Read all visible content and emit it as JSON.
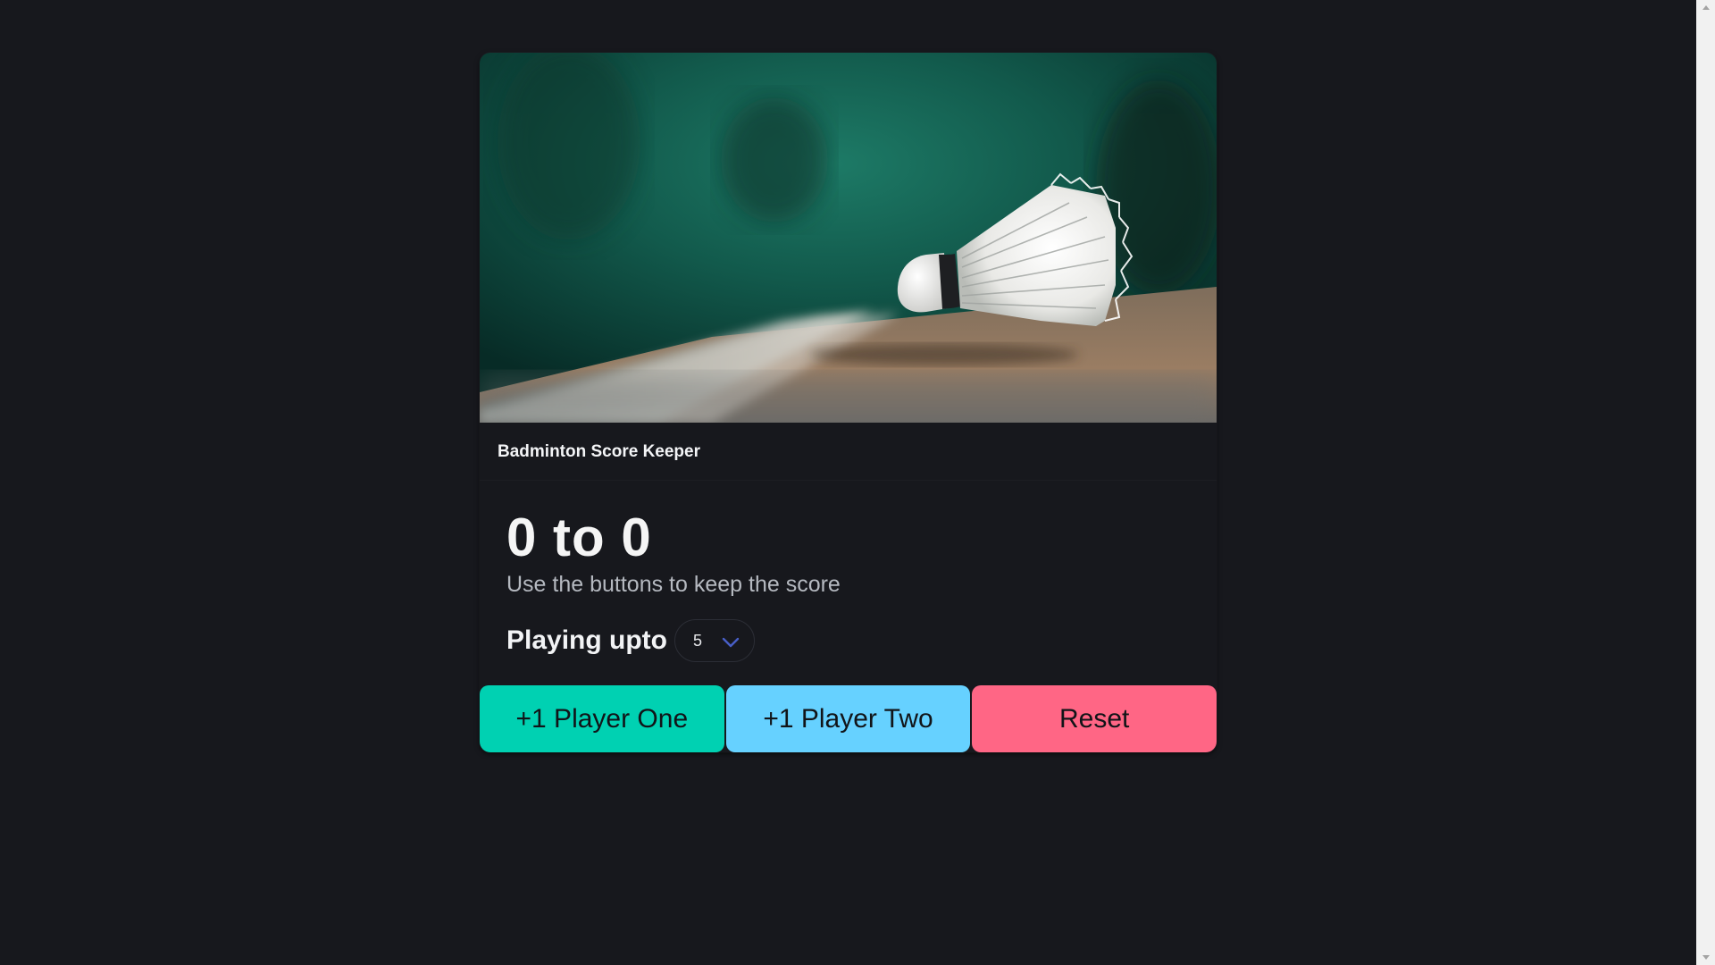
{
  "card": {
    "title": "Badminton Score Keeper",
    "image_alt": "shuttlecock-photo"
  },
  "score": {
    "text": "0 to 0",
    "hint": "Use the buttons to keep the score"
  },
  "upto": {
    "label": "Playing upto",
    "selected": "5",
    "icon": "chevron-down-icon"
  },
  "buttons": {
    "player_one": "+1 Player One",
    "player_two": "+1 Player Two",
    "reset": "Reset"
  },
  "colors": {
    "background": "#17181d",
    "player_one": "#00d1b2",
    "player_two": "#66d1ff",
    "reset": "#ff6685",
    "chevron": "#485fc7"
  }
}
